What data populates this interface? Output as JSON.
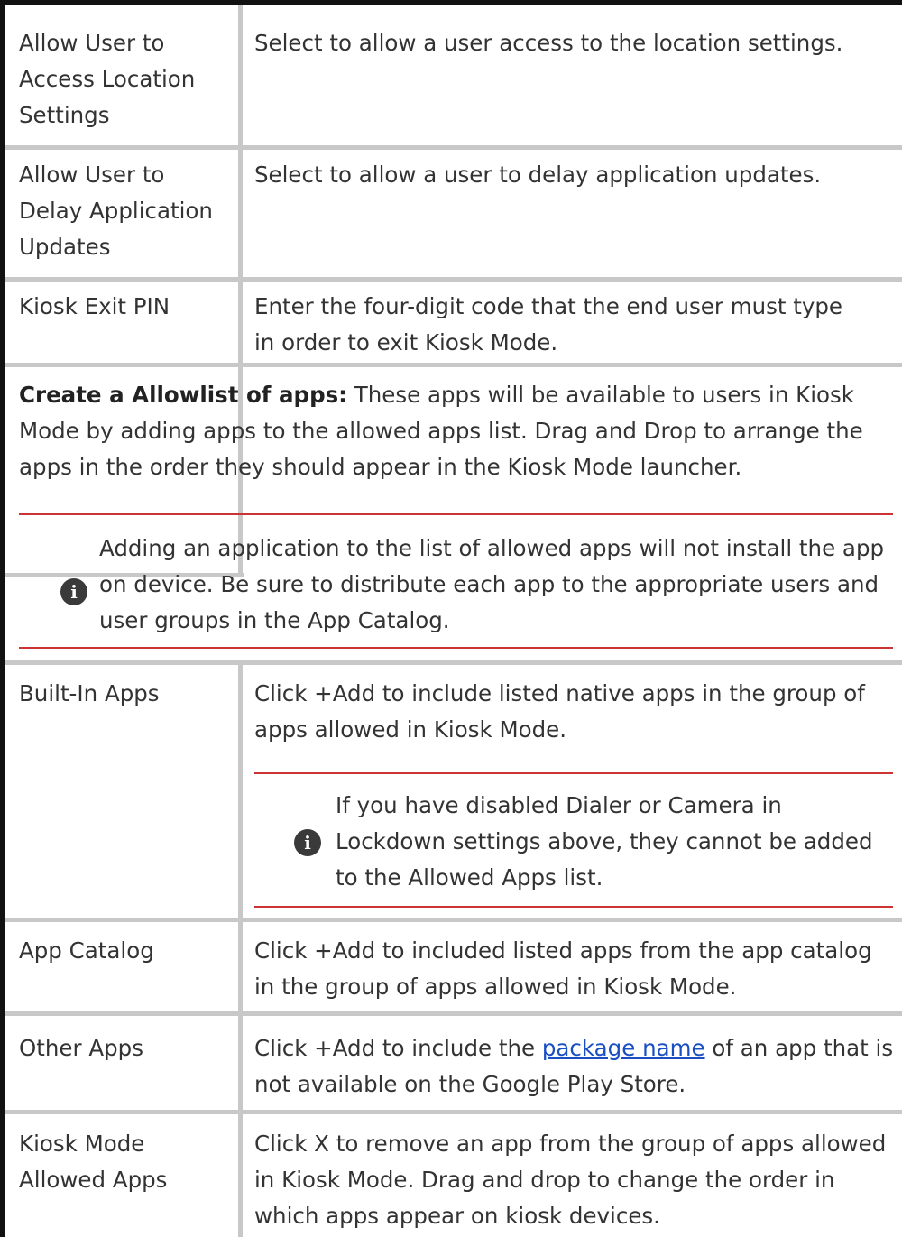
{
  "rows_top": [
    {
      "setting": "Allow User to Access Location Settings",
      "description": "Select to allow a user access to the location settings."
    },
    {
      "setting": "Allow User to Delay Application Updates",
      "description": "Select to allow a user to delay application updates."
    },
    {
      "setting": "Kiosk Exit PIN",
      "description": "Enter the four-digit code that the end user must type in order to exit Kiosk Mode."
    }
  ],
  "intro": {
    "bold": "Create a Allowlist of apps:",
    "text": " These apps will be available to users in Kiosk Mode by adding apps to the allowed apps list. Drag and Drop to arrange the apps in the order they should appear in the Kiosk Mode launcher."
  },
  "note_main": {
    "icon": "info-icon",
    "text": "Adding an application to the list of allowed apps will not install the app on device. Be sure to distribute each app to the appropriate users and user groups in the App Catalog."
  },
  "rows_bottom": [
    {
      "setting": "Built-In Apps",
      "description": "Click +Add to include listed native apps in the group of apps allowed in Kiosk Mode."
    },
    {
      "setting": "App Catalog",
      "description": "Click +Add to included listed apps from the app catalog in the group of apps allowed in Kiosk Mode."
    },
    {
      "setting": "Other Apps",
      "description_pre": "Click +Add to include the ",
      "link": "package name",
      "description_post": " of an app that is not available on the Google Play Store."
    },
    {
      "setting": "Kiosk Mode Allowed Apps",
      "description": "Click X to remove an app from the group of apps allowed in Kiosk Mode. Drag and drop to change the order in which apps appear on kiosk devices."
    }
  ],
  "note_builtin": {
    "icon": "info-icon",
    "text": "If you have disabled Dialer or Camera in Lockdown settings above, they cannot be added to the Allowed Apps list."
  },
  "colors": {
    "border": "#c8c8c8",
    "note_rule": "#cc3333",
    "link": "#1a4fc4",
    "frame": "#111111"
  }
}
